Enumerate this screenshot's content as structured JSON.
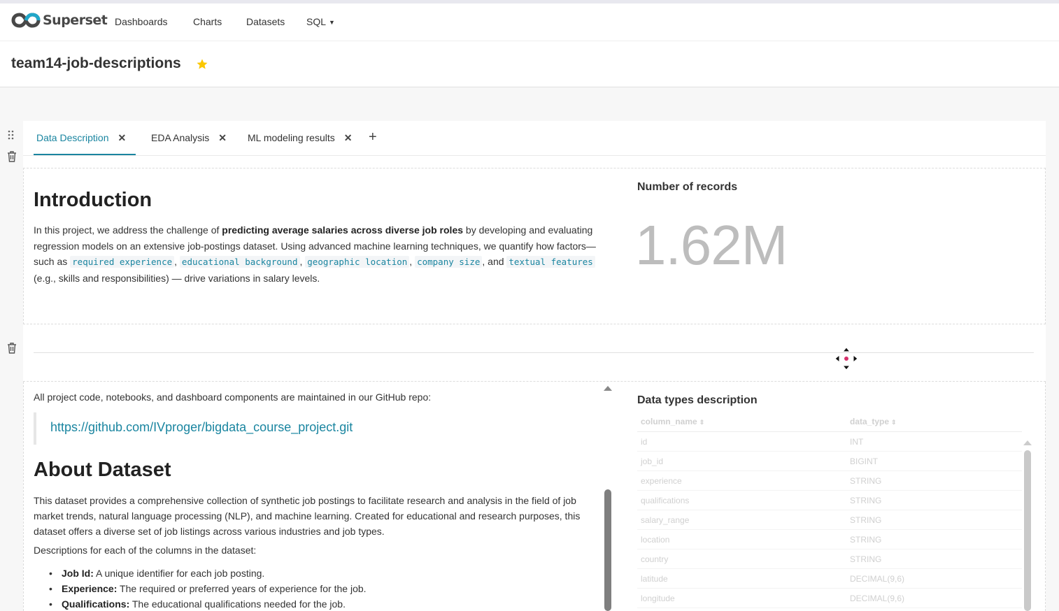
{
  "app": {
    "brand": "Superset"
  },
  "nav": {
    "items": [
      {
        "label": "Dashboards"
      },
      {
        "label": "Charts"
      },
      {
        "label": "Datasets"
      },
      {
        "label": "SQL"
      }
    ]
  },
  "dashboard": {
    "title": "team14-job-descriptions"
  },
  "tabs": [
    {
      "label": "Data Description",
      "active": true
    },
    {
      "label": "EDA Analysis"
    },
    {
      "label": "ML modeling results"
    }
  ],
  "intro": {
    "heading": "Introduction",
    "text_1": "In this project, we address the challenge of ",
    "bold": "predicting average salaries across diverse job roles",
    "text_2": " by developing and evaluating regression models on an extensive job-postings dataset. Using advanced machine learning techniques, we quantify how factors—such as ",
    "code_terms": [
      "required experience",
      "educational background",
      "geographic location",
      "company size",
      "textual features"
    ],
    "text_3": "and ",
    "text_4": " (e.g., skills and responsibilities) — drive variations in salary levels."
  },
  "big_number": {
    "title": "Number of records",
    "value": "1.62M"
  },
  "markdown": {
    "repo_text": "All project code, notebooks, and dashboard components are maintained in our GitHub repo:",
    "repo_link": "https://github.com/IVproger/bigdata_course_project.git",
    "about_heading": "About Dataset",
    "about_text": "This dataset provides a comprehensive collection of synthetic job postings to facilitate research and analysis in the field of job market trends, natural language processing (NLP), and machine learning. Created for educational and research purposes, this dataset offers a diverse set of job listings across various industries and job types.",
    "desc_text": "Descriptions for each of the columns in the dataset:",
    "columns": [
      {
        "name": "Job Id:",
        "desc": " A unique identifier for each job posting."
      },
      {
        "name": "Experience:",
        "desc": " The required or preferred years of experience for the job."
      },
      {
        "name": "Qualifications:",
        "desc": " The educational qualifications needed for the job."
      }
    ]
  },
  "types_table": {
    "title": "Data types description",
    "headers": [
      "column_name",
      "data_type"
    ],
    "rows": [
      [
        "id",
        "INT"
      ],
      [
        "job_id",
        "BIGINT"
      ],
      [
        "experience",
        "STRING"
      ],
      [
        "qualifications",
        "STRING"
      ],
      [
        "salary_range",
        "STRING"
      ],
      [
        "location",
        "STRING"
      ],
      [
        "country",
        "STRING"
      ],
      [
        "latitude",
        "DECIMAL(9,6)"
      ],
      [
        "longitude",
        "DECIMAL(9,6)"
      ]
    ]
  },
  "colors": {
    "accent": "#1a85a0",
    "star": "#fbc700",
    "big_number": "#bdbdbd"
  },
  "icons": [
    "superset-logo-icon",
    "star-icon",
    "drag-handle-icon",
    "trash-icon",
    "close-icon",
    "plus-icon",
    "move-icon",
    "caret-down-icon",
    "sort-icon"
  ]
}
